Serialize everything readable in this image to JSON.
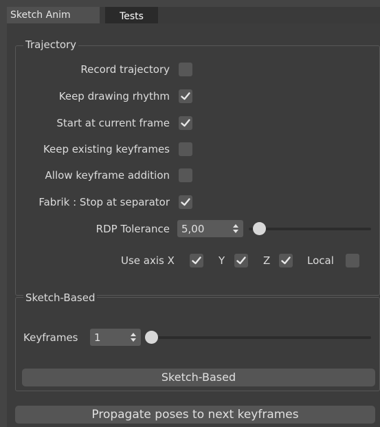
{
  "tabs": [
    {
      "label": "Sketch Anim"
    },
    {
      "label": "Tests"
    }
  ],
  "trajectory": {
    "title": "Trajectory",
    "options": [
      {
        "label": "Record trajectory",
        "checked": false
      },
      {
        "label": "Keep drawing rhythm",
        "checked": true
      },
      {
        "label": "Start at current frame",
        "checked": true
      },
      {
        "label": "Keep existing keyframes",
        "checked": false
      },
      {
        "label": "Allow keyframe addition",
        "checked": false
      },
      {
        "label": "Fabrik : Stop at separator",
        "checked": true
      }
    ],
    "rdp": {
      "label": "RDP Tolerance",
      "value": "5,00"
    },
    "axis": {
      "label": "Use axis X",
      "x_checked": true,
      "y_label": "Y",
      "y_checked": true,
      "z_label": "Z",
      "z_checked": true,
      "local_label": "Local",
      "local_checked": false
    }
  },
  "sketch_based": {
    "title": "Sketch-Based",
    "keyframes": {
      "label": "Keyframes",
      "value": "1"
    },
    "button_label": "Sketch-Based"
  },
  "propagate_button_label": "Propagate poses to next keyframes",
  "colors": {
    "background": "#3c3c3c",
    "checkbox": "#575757",
    "check_mark": "#e8e8e8"
  }
}
